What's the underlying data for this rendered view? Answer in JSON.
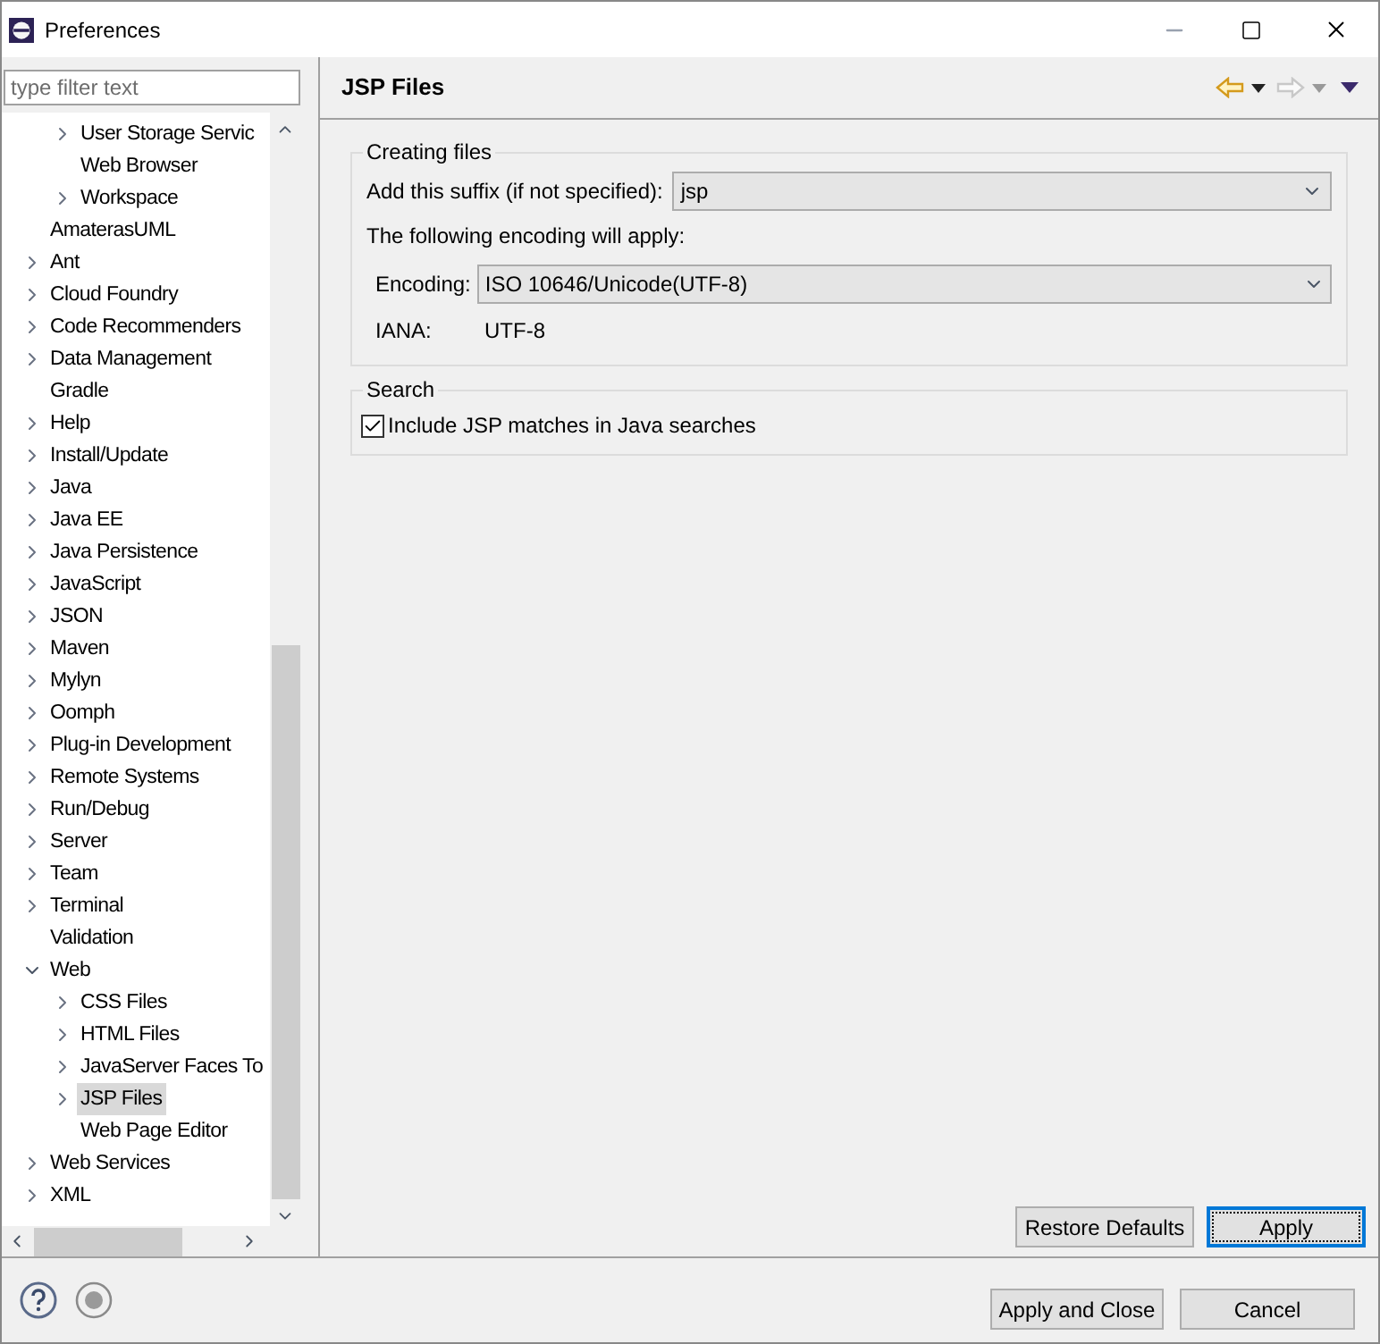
{
  "window": {
    "title": "Preferences"
  },
  "filter": {
    "placeholder": "type filter text"
  },
  "tree": {
    "continued_children": [
      {
        "label": "User Storage Servic",
        "expandable": true,
        "expanded": false,
        "selected": false
      },
      {
        "label": "Web Browser",
        "expandable": false,
        "selected": false
      },
      {
        "label": "Workspace",
        "expandable": true,
        "expanded": false,
        "selected": false
      }
    ],
    "items": [
      {
        "label": "AmaterasUML",
        "expandable": false,
        "selected": false
      },
      {
        "label": "Ant",
        "expandable": true,
        "expanded": false,
        "selected": false
      },
      {
        "label": "Cloud Foundry",
        "expandable": true,
        "expanded": false,
        "selected": false
      },
      {
        "label": "Code Recommenders",
        "expandable": true,
        "expanded": false,
        "selected": false
      },
      {
        "label": "Data Management",
        "expandable": true,
        "expanded": false,
        "selected": false
      },
      {
        "label": "Gradle",
        "expandable": false,
        "selected": false
      },
      {
        "label": "Help",
        "expandable": true,
        "expanded": false,
        "selected": false
      },
      {
        "label": "Install/Update",
        "expandable": true,
        "expanded": false,
        "selected": false
      },
      {
        "label": "Java",
        "expandable": true,
        "expanded": false,
        "selected": false
      },
      {
        "label": "Java EE",
        "expandable": true,
        "expanded": false,
        "selected": false
      },
      {
        "label": "Java Persistence",
        "expandable": true,
        "expanded": false,
        "selected": false
      },
      {
        "label": "JavaScript",
        "expandable": true,
        "expanded": false,
        "selected": false
      },
      {
        "label": "JSON",
        "expandable": true,
        "expanded": false,
        "selected": false
      },
      {
        "label": "Maven",
        "expandable": true,
        "expanded": false,
        "selected": false
      },
      {
        "label": "Mylyn",
        "expandable": true,
        "expanded": false,
        "selected": false
      },
      {
        "label": "Oomph",
        "expandable": true,
        "expanded": false,
        "selected": false
      },
      {
        "label": "Plug-in Development",
        "expandable": true,
        "expanded": false,
        "selected": false
      },
      {
        "label": "Remote Systems",
        "expandable": true,
        "expanded": false,
        "selected": false
      },
      {
        "label": "Run/Debug",
        "expandable": true,
        "expanded": false,
        "selected": false
      },
      {
        "label": "Server",
        "expandable": true,
        "expanded": false,
        "selected": false
      },
      {
        "label": "Team",
        "expandable": true,
        "expanded": false,
        "selected": false
      },
      {
        "label": "Terminal",
        "expandable": true,
        "expanded": false,
        "selected": false
      },
      {
        "label": "Validation",
        "expandable": false,
        "selected": false
      },
      {
        "label": "Web",
        "expandable": true,
        "expanded": true,
        "selected": false,
        "children": [
          {
            "label": "CSS Files",
            "expandable": true,
            "expanded": false,
            "selected": false
          },
          {
            "label": "HTML Files",
            "expandable": true,
            "expanded": false,
            "selected": false
          },
          {
            "label": "JavaServer Faces To",
            "expandable": true,
            "expanded": false,
            "selected": false
          },
          {
            "label": "JSP Files",
            "expandable": true,
            "expanded": false,
            "selected": true
          },
          {
            "label": "Web Page Editor",
            "expandable": false,
            "selected": false
          }
        ]
      },
      {
        "label": "Web Services",
        "expandable": true,
        "expanded": false,
        "selected": false
      },
      {
        "label": "XML",
        "expandable": true,
        "expanded": false,
        "selected": false
      }
    ]
  },
  "page": {
    "title": "JSP Files",
    "creating_files": {
      "title": "Creating files",
      "suffix_label": "Add this suffix (if not specified):",
      "suffix_value": "jsp",
      "encoding_note": "The following encoding will apply:",
      "encoding_label": "Encoding:",
      "encoding_value": "ISO 10646/Unicode(UTF-8)",
      "iana_label": "IANA:",
      "iana_value": "UTF-8"
    },
    "search": {
      "title": "Search",
      "include_label": "Include JSP matches in Java searches",
      "checked": true
    },
    "buttons": [
      "Restore Defaults",
      "Apply"
    ]
  },
  "footer_buttons": [
    "Apply and Close",
    "Cancel"
  ]
}
